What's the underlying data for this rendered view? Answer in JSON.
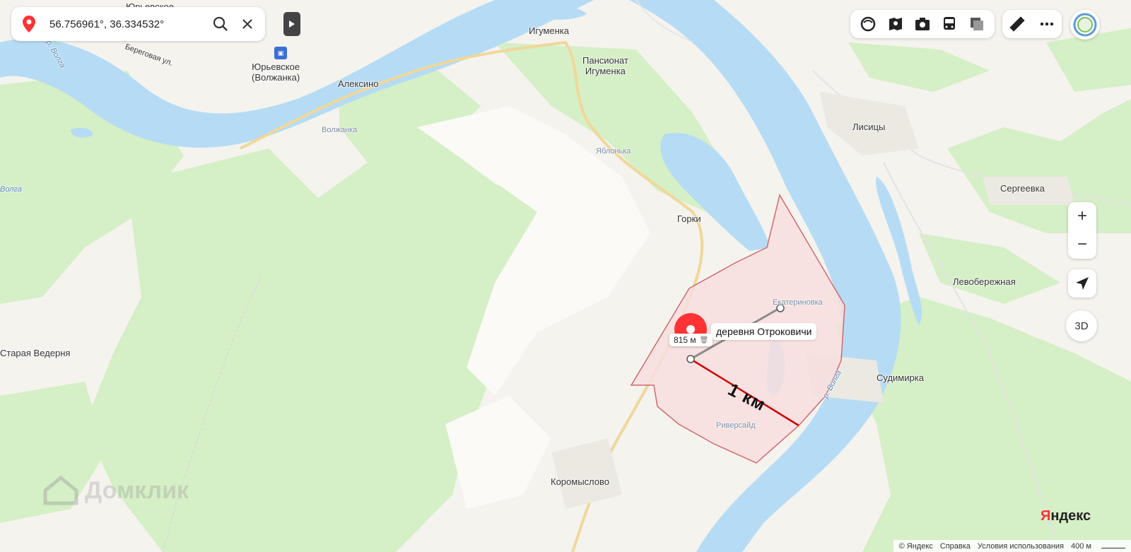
{
  "search": {
    "coordinates": "56.756961°, 36.334532°"
  },
  "places": {
    "yuryevskoe_top": "Юрьевское",
    "beregovaya": "Береговая ул.",
    "yuryevskoe": "Юрьевское\n(Волжанка)",
    "igumenka": "Игуменка",
    "pansionat": "Пансионат\nИгуменка",
    "aleksino": "Алексино",
    "volzhanka": "Волжанка",
    "yablonka": "Яблонька",
    "lisitsy": "Лисицы",
    "sergeevka": "Сергеевка",
    "gorki": "Горки",
    "ekaterinovka": "Екатериновка",
    "otrokovichi": "деревня Отроковичи",
    "levoberezhnaya": "Левобережная",
    "staraya_vederna": "Старая Ведерня",
    "sudimirka": "Судимирка",
    "riversaid": "Риверсайд",
    "koromyslovo": "Коромыслово",
    "volga_left": "Волга",
    "volga_river": "р. Волга",
    "volga_top": "р. Волга"
  },
  "measurement": {
    "distance": "815 м",
    "scale_annotation": "1 км"
  },
  "watermark": "Домклик",
  "controls": {
    "zoom_in": "+",
    "zoom_out": "−",
    "btn_3d": "3D"
  },
  "footer": {
    "copyright": "© Яндекс",
    "help": "Справка",
    "terms": "Условия использования",
    "scale": "400 м"
  },
  "logo": {
    "y": "Я",
    "rest": "ндекс"
  },
  "colors": {
    "water": "#b5dcf4",
    "forest": "#d5efc6",
    "land": "#f5f3ee",
    "polygon_fill": "#f7dede",
    "polygon_stroke": "#d0696f",
    "marker": "#ff3333",
    "measure_line": "#d00000"
  },
  "icons": [
    "map-pin-icon",
    "search-icon",
    "close-icon",
    "play-icon",
    "layers-icon",
    "panorama-icon",
    "camera-icon",
    "bus-icon",
    "traffic-icon",
    "ruler-icon",
    "more-icon",
    "user-avatar-icon",
    "locate-arrow-icon",
    "bus-stop-icon"
  ]
}
